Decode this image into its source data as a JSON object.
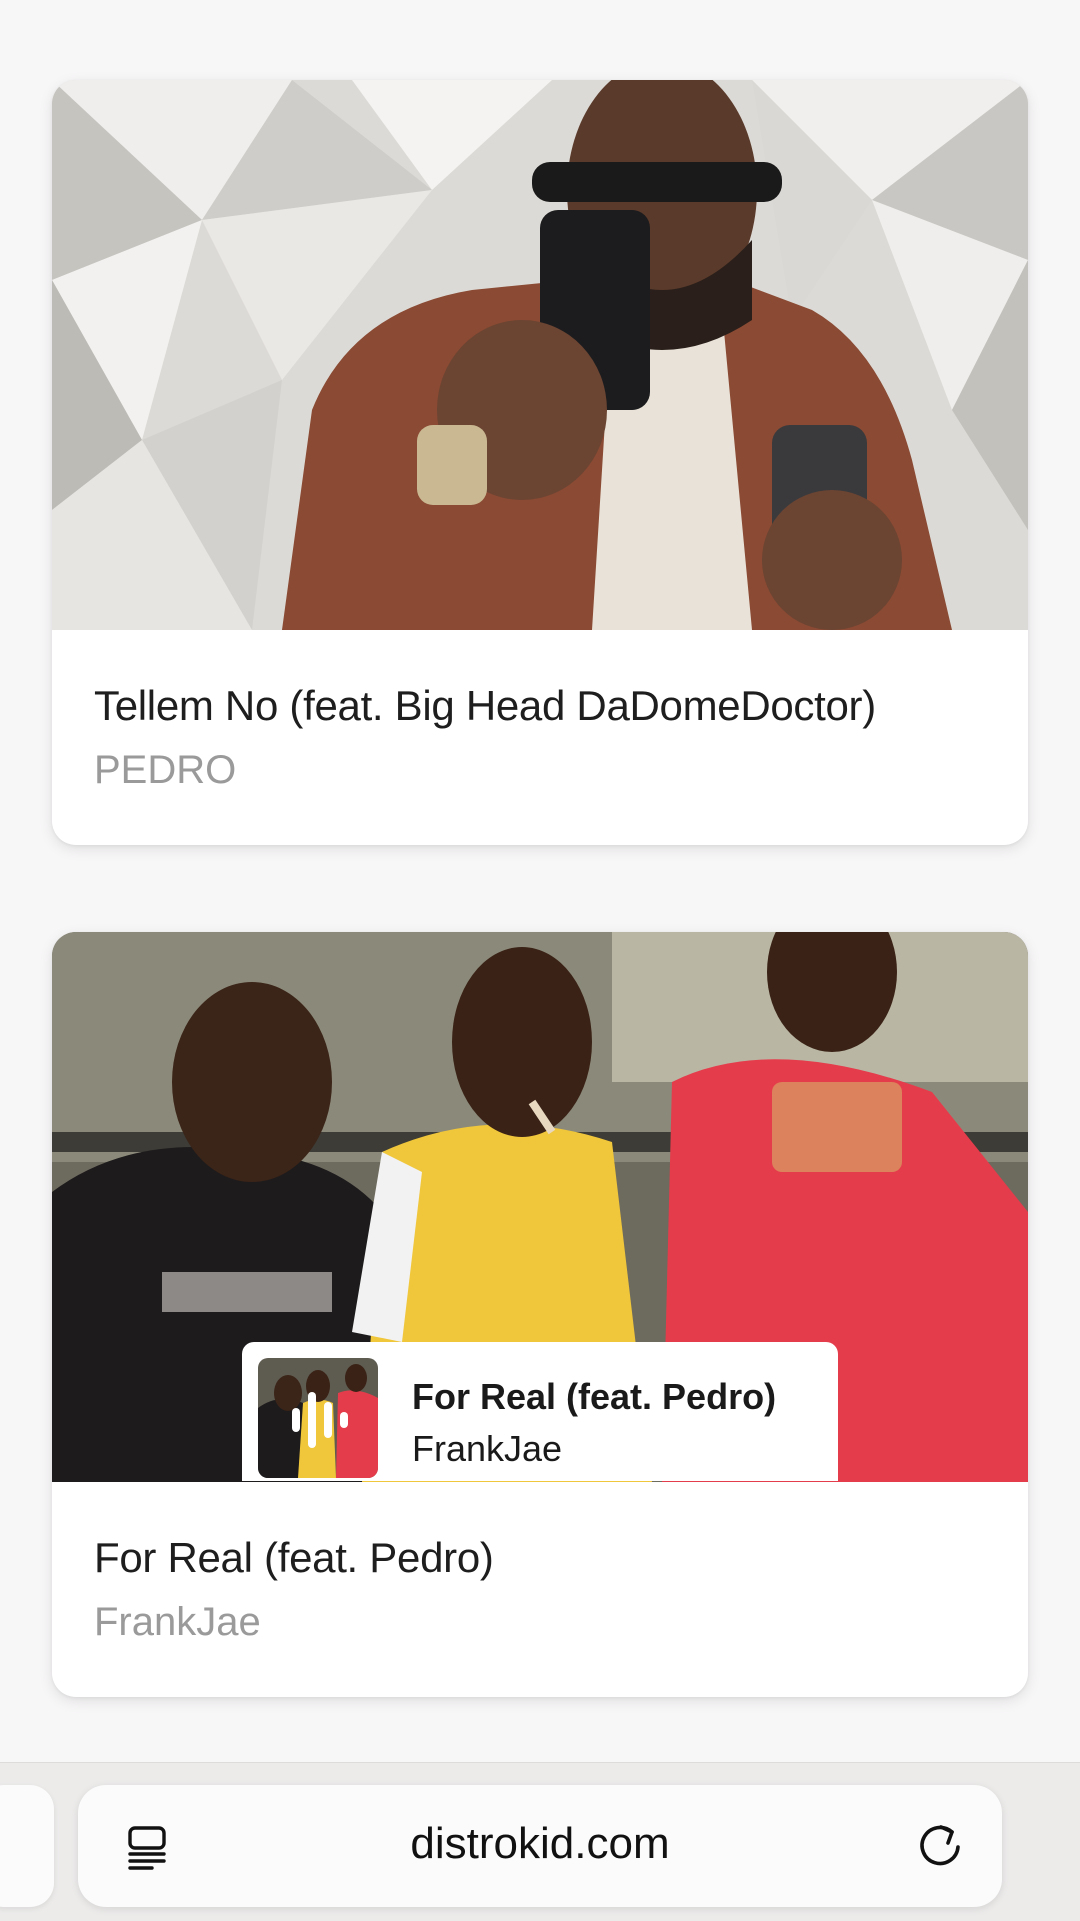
{
  "cards": [
    {
      "title": "Tellem No (feat. Big Head DaDomeDoctor)",
      "artist": "PEDRO"
    },
    {
      "title": "For Real (feat. Pedro)",
      "artist": "FrankJae"
    }
  ],
  "now_playing": {
    "title": "For Real (feat. Pedro)",
    "artist": "FrankJae"
  },
  "browser": {
    "url": "distrokid.com"
  },
  "icons": {
    "reader": "reader-mode-icon",
    "reload": "reload-icon",
    "playing": "audio-wave-icon"
  }
}
